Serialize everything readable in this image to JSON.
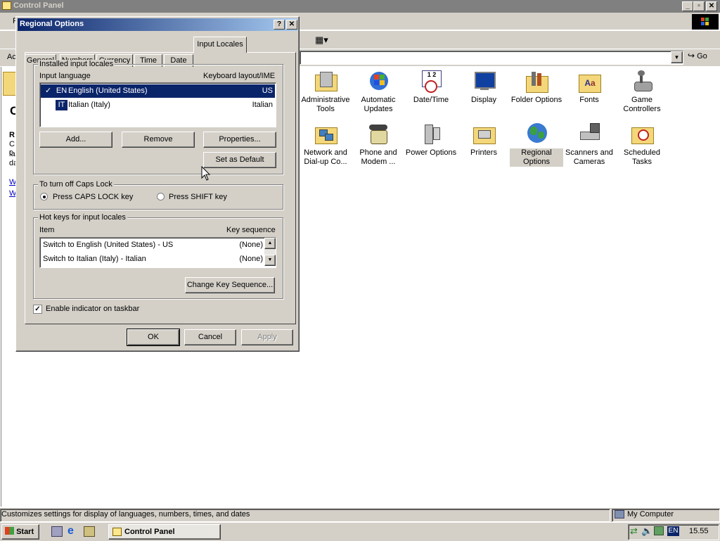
{
  "window": {
    "title": "Control Panel",
    "address_label": "Ac",
    "go_label": "Go"
  },
  "control_panel_items": [
    {
      "label": "Administrative Tools",
      "icon": "administrative-tools-icon"
    },
    {
      "label": "Automatic Updates",
      "icon": "automatic-updates-icon"
    },
    {
      "label": "Date/Time",
      "icon": "date-time-icon"
    },
    {
      "label": "Display",
      "icon": "display-icon"
    },
    {
      "label": "Folder Options",
      "icon": "folder-options-icon"
    },
    {
      "label": "Fonts",
      "icon": "fonts-icon"
    },
    {
      "label": "Game Controllers",
      "icon": "game-controllers-icon"
    },
    {
      "label": "Network and Dial-up Co...",
      "icon": "network-icon"
    },
    {
      "label": "Phone and Modem ...",
      "icon": "phone-modem-icon"
    },
    {
      "label": "Power Options",
      "icon": "power-options-icon"
    },
    {
      "label": "Printers",
      "icon": "printers-icon"
    },
    {
      "label": "Regional Options",
      "icon": "regional-options-icon"
    },
    {
      "label": "Scanners and Cameras",
      "icon": "scanners-cameras-icon"
    },
    {
      "label": "Scheduled Tasks",
      "icon": "scheduled-tasks-icon"
    }
  ],
  "left_pane": {
    "heading_letter": "C",
    "bold_letter": "R",
    "lines": [
      "C",
      "c",
      "la",
      "da"
    ],
    "links": [
      "W",
      "W"
    ]
  },
  "dialog": {
    "title": "Regional Options",
    "tabs": [
      "General",
      "Numbers",
      "Currency",
      "Time",
      "Date",
      "Input Locales"
    ],
    "active_tab": "Input Locales",
    "installed": {
      "group_label": "Installed input locales",
      "col_language": "Input language",
      "col_layout": "Keyboard layout/IME",
      "rows": [
        {
          "check": "✓",
          "code": "EN",
          "language": "English (United States)",
          "layout": "US"
        },
        {
          "check": "",
          "code": "IT",
          "language": "Italian (Italy)",
          "layout": "Italian"
        }
      ],
      "add": "Add...",
      "remove": "Remove",
      "properties": "Properties...",
      "set_default": "Set as Default"
    },
    "caps": {
      "group_label": "To turn off Caps Lock",
      "option1": "Press CAPS LOCK key",
      "option2": "Press SHIFT key"
    },
    "hotkeys": {
      "group_label": "Hot keys for input locales",
      "col_item": "Item",
      "col_seq": "Key sequence",
      "rows": [
        {
          "item": "Switch to English (United States) - US",
          "seq": "(None)"
        },
        {
          "item": "Switch to Italian (Italy) - Italian",
          "seq": "(None)"
        }
      ],
      "change": "Change Key Sequence..."
    },
    "enable_indicator": "Enable indicator on taskbar",
    "ok": "OK",
    "cancel": "Cancel",
    "apply": "Apply"
  },
  "statusbar": {
    "text": "Customizes settings for display of languages, numbers, times, and dates",
    "zone": "My Computer"
  },
  "taskbar": {
    "start": "Start",
    "task": "Control Panel",
    "lang": "EN",
    "clock": "15.55"
  },
  "colors": {
    "titlebar_active": "#0a246a",
    "titlebar_inactive": "#808080",
    "face": "#d4d0c8",
    "selection": "#0a246a"
  }
}
